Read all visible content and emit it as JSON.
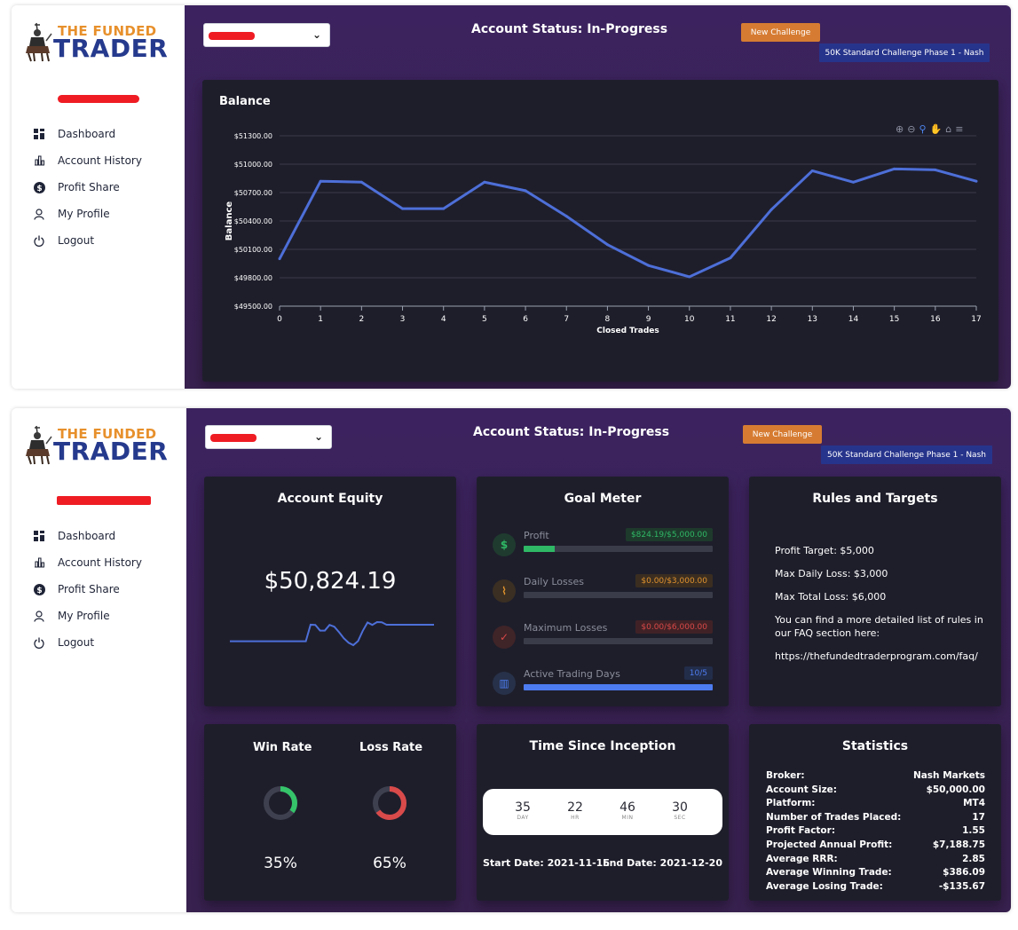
{
  "brand": {
    "line1": "THE FUNDED",
    "line2": "TRADER"
  },
  "menu": [
    {
      "label": "Dashboard",
      "icon": "dashboard-icon"
    },
    {
      "label": "Account History",
      "icon": "bar-chart-icon"
    },
    {
      "label": "Profit Share",
      "icon": "dollar-icon"
    },
    {
      "label": "My Profile",
      "icon": "user-icon"
    },
    {
      "label": "Logout",
      "icon": "power-icon"
    }
  ],
  "header": {
    "status": "Account Status: In-Progress",
    "new_challenge": "New Challenge",
    "challenge_name": "50K Standard Challenge Phase 1 - Nash"
  },
  "balance_card": {
    "title": "Balance"
  },
  "chart_data": {
    "type": "line",
    "title": "Balance",
    "xlabel": "Closed Trades",
    "ylabel": "Balance",
    "x": [
      0,
      1,
      2,
      3,
      4,
      5,
      6,
      7,
      8,
      9,
      10,
      11,
      12,
      13,
      14,
      15,
      16,
      17
    ],
    "series": [
      {
        "values": [
          50000,
          50820,
          50810,
          50530,
          50530,
          50810,
          50720,
          50450,
          50150,
          49930,
          49810,
          50010,
          50520,
          50930,
          50810,
          50950,
          50940,
          50820
        ]
      }
    ],
    "yticks": [
      "$51300.00",
      "$51000.00",
      "$50700.00",
      "$50400.00",
      "$50100.00",
      "$49800.00",
      "$49500.00"
    ],
    "ylim": [
      49500,
      51300
    ],
    "xlim": [
      0,
      17
    ],
    "grid": true,
    "line_color": "#4d6fd8"
  },
  "equity": {
    "title": "Account Equity",
    "value": "$50,824.19",
    "spark": [
      50000,
      50000,
      50000,
      50000,
      50000,
      50000,
      50000,
      50000,
      50000,
      50000,
      50000,
      50000,
      50000,
      50000,
      50000,
      50000,
      50000,
      50820,
      50810,
      50530,
      50530,
      50810,
      50720,
      50450,
      50150,
      49930,
      49810,
      50010,
      50520,
      50930,
      50810,
      50950,
      50940,
      50820,
      50820,
      50820,
      50820,
      50820,
      50820,
      50820,
      50820,
      50820,
      50820,
      50820
    ]
  },
  "goal": {
    "title": "Goal Meter",
    "rows": [
      {
        "label": "Profit",
        "badge": "$824.19/$5,000.00",
        "fraction": 0.165,
        "color": "#2fb865",
        "icon": "dollar-icon",
        "glyph": "$"
      },
      {
        "label": "Daily Losses",
        "badge": "$0.00/$3,000.00",
        "fraction": 0.0,
        "color": "#e0922e",
        "icon": "trend-icon",
        "glyph": "⌇"
      },
      {
        "label": "Maximum Losses",
        "badge": "$0.00/$6,000.00",
        "fraction": 0.0,
        "color": "#d94848",
        "icon": "check-icon",
        "glyph": "✓"
      },
      {
        "label": "Active Trading Days",
        "badge": "10/5",
        "fraction": 1.0,
        "color": "#4d7cf0",
        "icon": "chart-icon",
        "glyph": "▥"
      }
    ]
  },
  "rules": {
    "title": "Rules and Targets",
    "profit_target": "Profit Target: $5,000",
    "max_daily": "Max Daily Loss: $3,000",
    "max_total": "Max Total Loss: $6,000",
    "note": "You can find a more detailed list of rules in our FAQ section here:",
    "link": "https://thefundedtraderprogram.com/faq/"
  },
  "rates": {
    "win_label": "Win Rate",
    "loss_label": "Loss Rate",
    "win_value": "35%",
    "loss_value": "65%",
    "win_fraction": 0.35,
    "loss_fraction": 0.65,
    "win_color": "#35c46a",
    "loss_color": "#d94a4a"
  },
  "timer": {
    "title": "Time Since Inception",
    "units": [
      {
        "value": "35",
        "unit": "DAY"
      },
      {
        "value": "22",
        "unit": "HR"
      },
      {
        "value": "46",
        "unit": "MIN"
      },
      {
        "value": "30",
        "unit": "SEC"
      }
    ],
    "start": "Start Date: 2021-11-15",
    "end": "End Date: 2021-12-20"
  },
  "statistics": {
    "title": "Statistics",
    "rows": [
      {
        "k": "Broker:",
        "v": "Nash Markets"
      },
      {
        "k": "Account Size:",
        "v": "$50,000.00"
      },
      {
        "k": "Platform:",
        "v": "MT4"
      },
      {
        "k": "Number of Trades Placed:",
        "v": "17"
      },
      {
        "k": "Profit Factor:",
        "v": "1.55"
      },
      {
        "k": "Projected Annual Profit:",
        "v": "$7,188.75"
      },
      {
        "k": "Average RRR:",
        "v": "2.85"
      },
      {
        "k": "Average Winning Trade:",
        "v": "$386.09"
      },
      {
        "k": "Average Losing Trade:",
        "v": "-$135.67"
      }
    ]
  }
}
